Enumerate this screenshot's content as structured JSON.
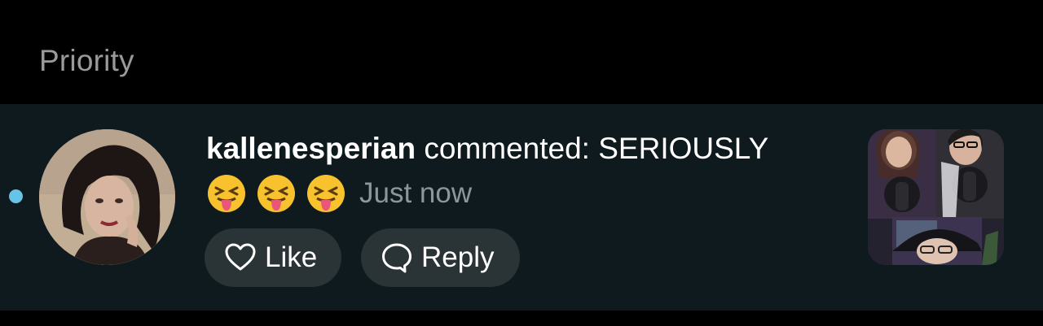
{
  "section": {
    "title": "Priority"
  },
  "notification": {
    "unread": true,
    "username": "kallenesperian",
    "action_text": " commented: SERIOUSLY",
    "emojis": [
      "squinting-face-with-tongue",
      "squinting-face-with-tongue",
      "squinting-face-with-tongue"
    ],
    "timestamp": "Just now",
    "like_label": "Like",
    "reply_label": "Reply"
  },
  "colors": {
    "background": "#000000",
    "row_background": "#0e1a1d",
    "unread_dot": "#67c3e8",
    "button_background": "#2a3437",
    "muted_text": "#8d9698",
    "header_text": "#9a9a9a"
  },
  "icons": {
    "like": "heart-outline-icon",
    "reply": "speech-bubble-outline-icon"
  }
}
